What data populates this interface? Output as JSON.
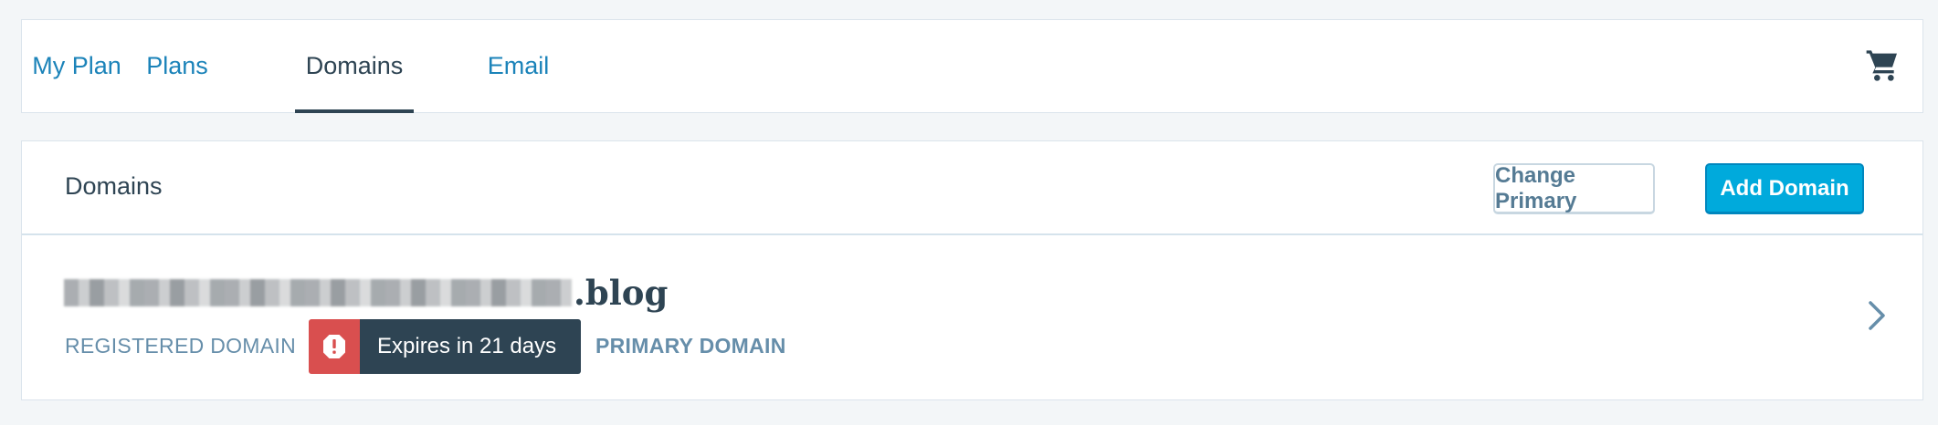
{
  "nav": {
    "tabs": [
      {
        "label": "My Plan",
        "selected": false
      },
      {
        "label": "Plans",
        "selected": false
      },
      {
        "label": "Domains",
        "selected": true
      },
      {
        "label": "Email",
        "selected": false
      }
    ],
    "cart_icon": "cart-icon"
  },
  "card": {
    "title": "Domains",
    "change_primary_label": "Change Primary",
    "add_domain_label": "Add Domain"
  },
  "domain": {
    "tld": ".blog",
    "type_label": "REGISTERED DOMAIN",
    "expiry_label": "Expires in 21 days",
    "expiry_icon": "alert-icon",
    "primary_label": "PRIMARY DOMAIN",
    "chevron_icon": "chevron-right-icon"
  },
  "colors": {
    "accent": "#1b83b9",
    "primary_button": "#00aadc",
    "alert": "#d94f4f",
    "dark": "#2e4453"
  }
}
